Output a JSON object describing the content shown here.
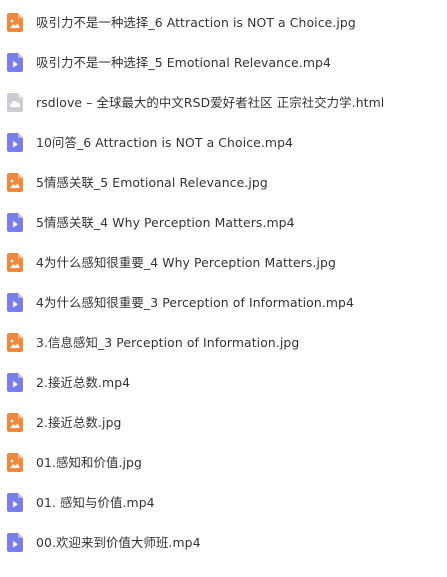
{
  "colors": {
    "image_icon": "#F5873A",
    "video_icon": "#7A7DF0",
    "web_icon": "#C9CDD4",
    "text": "#333333"
  },
  "icons": {
    "jpg": "image-file-icon",
    "mp4": "video-file-icon",
    "html": "web-file-icon"
  },
  "files": [
    {
      "name": "吸引力不是一种选择_6 Attraction is NOT a Choice.jpg",
      "type": "jpg"
    },
    {
      "name": "吸引力不是一种选择_5 Emotional Relevance.mp4",
      "type": "mp4"
    },
    {
      "name": "rsdlove – 全球最大的中文RSD爱好者社区 正宗社交力学.html",
      "type": "html"
    },
    {
      "name": "10问答_6 Attraction is NOT a Choice.mp4",
      "type": "mp4"
    },
    {
      "name": "5情感关联_5 Emotional Relevance.jpg",
      "type": "jpg"
    },
    {
      "name": "5情感关联_4 Why Perception Matters.mp4",
      "type": "mp4"
    },
    {
      "name": "4为什么感知很重要_4 Why Perception Matters.jpg",
      "type": "jpg"
    },
    {
      "name": "4为什么感知很重要_3 Perception of Information.mp4",
      "type": "mp4"
    },
    {
      "name": "3.信息感知_3 Perception of Information.jpg",
      "type": "jpg"
    },
    {
      "name": "2.接近总数.mp4",
      "type": "mp4"
    },
    {
      "name": "2.接近总数.jpg",
      "type": "jpg"
    },
    {
      "name": "01.感知和价值.jpg",
      "type": "jpg"
    },
    {
      "name": "01. 感知与价值.mp4",
      "type": "mp4"
    },
    {
      "name": "00.欢迎来到价值大师班.mp4",
      "type": "mp4"
    }
  ]
}
